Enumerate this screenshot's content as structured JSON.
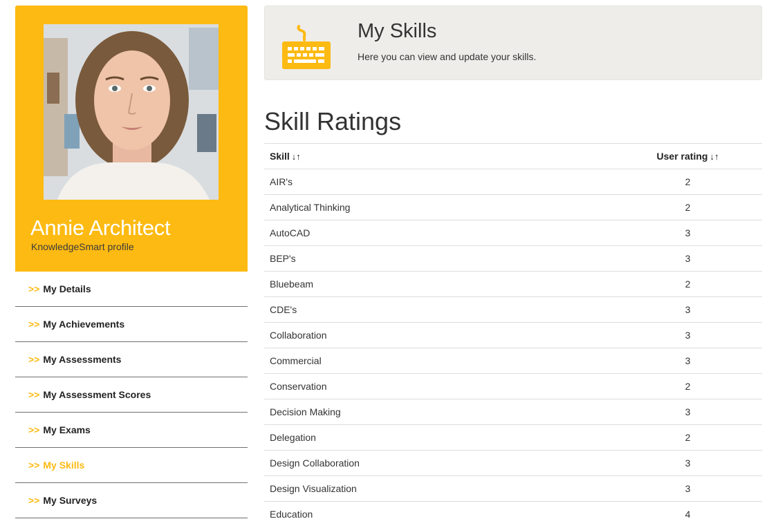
{
  "profile": {
    "name": "Annie Architect",
    "subtitle": "KnowledgeSmart profile"
  },
  "nav": {
    "chevron": ">>",
    "items": [
      {
        "label": "My Details",
        "active": false
      },
      {
        "label": "My Achievements",
        "active": false
      },
      {
        "label": "My Assessments",
        "active": false
      },
      {
        "label": "My Assessment Scores",
        "active": false
      },
      {
        "label": "My Exams",
        "active": false
      },
      {
        "label": "My Skills",
        "active": true
      },
      {
        "label": "My Surveys",
        "active": false
      }
    ]
  },
  "header": {
    "icon": "keyboard-icon",
    "title": "My Skills",
    "description": "Here you can view and update your skills."
  },
  "section": {
    "title": "Skill Ratings"
  },
  "table": {
    "columns": [
      "Skill",
      "User rating"
    ],
    "sort_glyph": "↓↑",
    "rows": [
      {
        "skill": "AIR's",
        "rating": "2"
      },
      {
        "skill": "Analytical Thinking",
        "rating": "2"
      },
      {
        "skill": "AutoCAD",
        "rating": "3"
      },
      {
        "skill": "BEP's",
        "rating": "3"
      },
      {
        "skill": "Bluebeam",
        "rating": "2"
      },
      {
        "skill": "CDE's",
        "rating": "3"
      },
      {
        "skill": "Collaboration",
        "rating": "3"
      },
      {
        "skill": "Commercial",
        "rating": "3"
      },
      {
        "skill": "Conservation",
        "rating": "2"
      },
      {
        "skill": "Decision Making",
        "rating": "3"
      },
      {
        "skill": "Delegation",
        "rating": "2"
      },
      {
        "skill": "Design Collaboration",
        "rating": "3"
      },
      {
        "skill": "Design Visualization",
        "rating": "3"
      },
      {
        "skill": "Education",
        "rating": "4"
      }
    ]
  },
  "colors": {
    "accent": "#fdba12",
    "header_bg": "#eeedea"
  }
}
